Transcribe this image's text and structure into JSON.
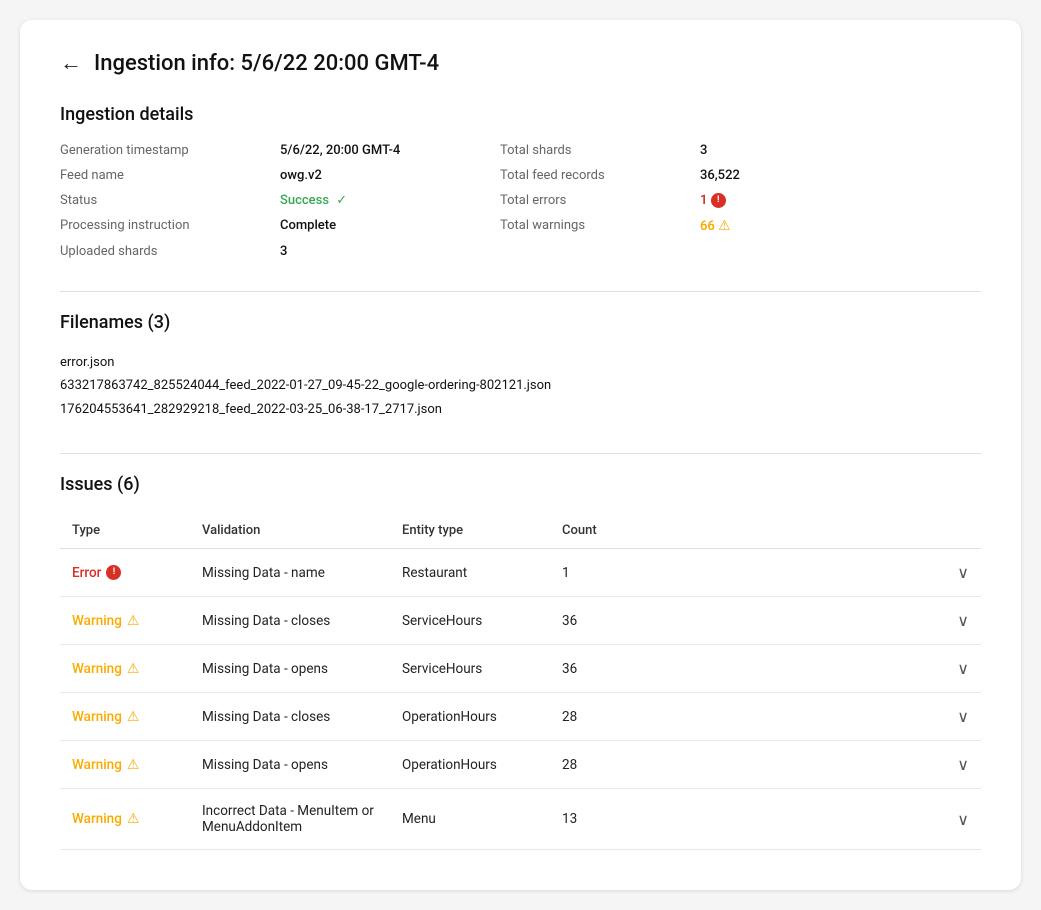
{
  "header": {
    "back_label": "←",
    "title": "Ingestion info: 5/6/22 20:00 GMT-4"
  },
  "ingestion_details": {
    "section_title": "Ingestion details",
    "fields_left": [
      {
        "label": "Generation timestamp",
        "value": "5/6/22, 20:00 GMT-4"
      },
      {
        "label": "Feed name",
        "value": "owg.v2"
      },
      {
        "label": "Status",
        "value": "Success"
      },
      {
        "label": "Processing instruction",
        "value": "Complete"
      },
      {
        "label": "Uploaded shards",
        "value": "3"
      }
    ],
    "fields_right": [
      {
        "label": "Total shards",
        "value": "3"
      },
      {
        "label": "Total feed records",
        "value": "36,522"
      },
      {
        "label": "Total errors",
        "value": "1",
        "type": "error"
      },
      {
        "label": "Total warnings",
        "value": "66",
        "type": "warning"
      }
    ]
  },
  "filenames": {
    "section_title": "Filenames (3)",
    "files": [
      "error.json",
      "633217863742_825524044_feed_2022-01-27_09-45-22_google-ordering-802121.json",
      "176204553641_282929218_feed_2022-03-25_06-38-17_2717.json"
    ]
  },
  "issues": {
    "section_title": "Issues (6)",
    "columns": [
      "Type",
      "Validation",
      "Entity type",
      "Count",
      ""
    ],
    "rows": [
      {
        "type": "Error",
        "type_kind": "error",
        "validation": "Missing Data - name",
        "entity_type": "Restaurant",
        "count": "1"
      },
      {
        "type": "Warning",
        "type_kind": "warning",
        "validation": "Missing Data - closes",
        "entity_type": "ServiceHours",
        "count": "36"
      },
      {
        "type": "Warning",
        "type_kind": "warning",
        "validation": "Missing Data - opens",
        "entity_type": "ServiceHours",
        "count": "36"
      },
      {
        "type": "Warning",
        "type_kind": "warning",
        "validation": "Missing Data - closes",
        "entity_type": "OperationHours",
        "count": "28"
      },
      {
        "type": "Warning",
        "type_kind": "warning",
        "validation": "Missing Data - opens",
        "entity_type": "OperationHours",
        "count": "28"
      },
      {
        "type": "Warning",
        "type_kind": "warning",
        "validation": "Incorrect Data - MenuItem or MenuAddonItem",
        "entity_type": "Menu",
        "count": "13"
      }
    ]
  }
}
